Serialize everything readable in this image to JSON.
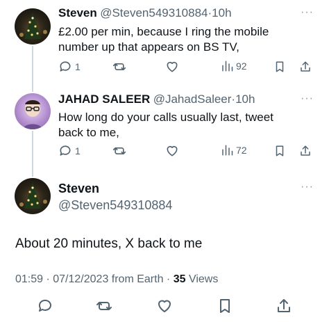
{
  "tweets": [
    {
      "name": "Steven",
      "handle": "@Steven549310884",
      "separator": "·",
      "time": "10h",
      "more": "···",
      "line1": "£2.00 per min,  because I ring the mobile",
      "line2": "number up that appears on BS TV,",
      "replies": "1",
      "views": "92"
    },
    {
      "name": "JAHAD SALEER",
      "handle": "@JahadSaleer",
      "separator": "·",
      "time": "10h",
      "more": "···",
      "line1": "How long do your calls usually last, tweet",
      "line2": "back to me,",
      "replies": "1",
      "views": "72"
    }
  ],
  "main": {
    "name": "Steven",
    "handle": "@Steven549310884",
    "more": "···",
    "text": "About 20 minutes,  X back to me",
    "timestamp": "01:59 · 07/12/2023 from Earth ·",
    "views_count": "35",
    "views_label": "Views"
  },
  "colors": {
    "text": "#0f1419",
    "muted": "#536471",
    "thread_line": "#cfd9de"
  }
}
